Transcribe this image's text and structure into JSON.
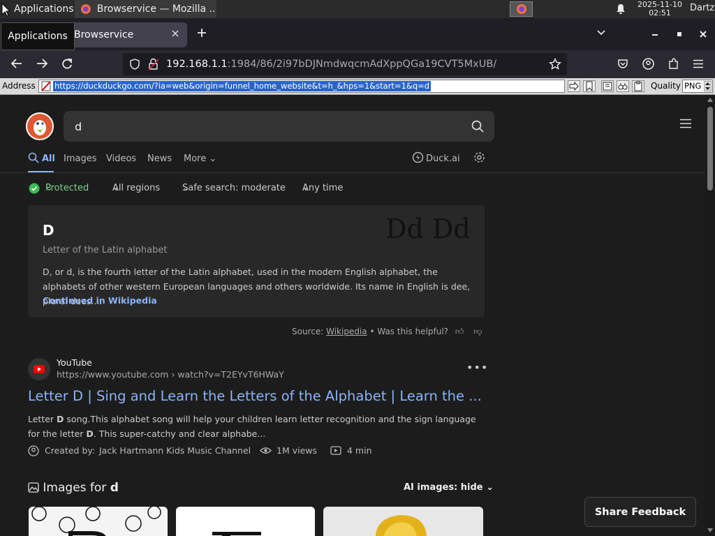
{
  "taskbar": {
    "applications_label": "Applications",
    "task_title": "Browservice — Mozilla ...",
    "date": "2025-11-10",
    "time": "02:51",
    "user": "Dartz"
  },
  "tooltip": "Applications",
  "browser": {
    "tab_title": "Browservice",
    "url_host": "192.168.1.1",
    "url_path": ":1984/86/2i97bDJNmdwqcmAdXppQGa19CVT5MxUB/"
  },
  "address_toolbar": {
    "label": "Address",
    "value": "https://duckduckgo.com/?ia=web&origin=funnel_home_website&t=h_&hps=1&start=1&q=d",
    "quality_label": "Quality",
    "format": "PNG"
  },
  "search": {
    "query": "d",
    "tabs": [
      "All",
      "Images",
      "Videos",
      "News",
      "More"
    ],
    "duck_ai": "Duck.ai",
    "filters": {
      "protected": "Protected",
      "regions": "All regions",
      "safe_search": "Safe search: moderate",
      "time": "Any time"
    }
  },
  "infobox": {
    "title": "D",
    "subtitle": "Letter of the Latin alphabet",
    "glyphs": "Dd Dd",
    "description": "D, or d, is the fourth letter of the Latin alphabet, used in the modern English alphabet, the alphabets of other western European languages and others worldwide. Its name in English is dee, plural dees....",
    "more_link": "Continued in Wikipedia",
    "source_label": "Source:",
    "source_link": "Wikipedia",
    "helpful": "• Was this helpful?"
  },
  "result": {
    "site": "YouTube",
    "url": "https://www.youtube.com › watch?v=T2EYvT6HWaY",
    "title": "Letter D | Sing and Learn the Letters of the Alphabet | Learn the ...",
    "desc_1": "Letter ",
    "desc_b1": "D",
    "desc_2": " song.This alphabet song will help your children learn letter recognition and the sign language for the letter ",
    "desc_b2": "D",
    "desc_3": ". This super-catchy and clear alphabe...",
    "created_label": "Created by:",
    "creator": "Jack Hartmann Kids Music Channel",
    "views": "1M views",
    "duration": "4 min"
  },
  "images": {
    "heading_prefix": "Images for ",
    "heading_query": "d",
    "ai_toggle": "AI images: hide"
  },
  "feedback": "Share Feedback",
  "colors": {
    "accent_link": "#8ab4f8",
    "protected_green": "#3cba54",
    "ddg_orange": "#de5833"
  }
}
